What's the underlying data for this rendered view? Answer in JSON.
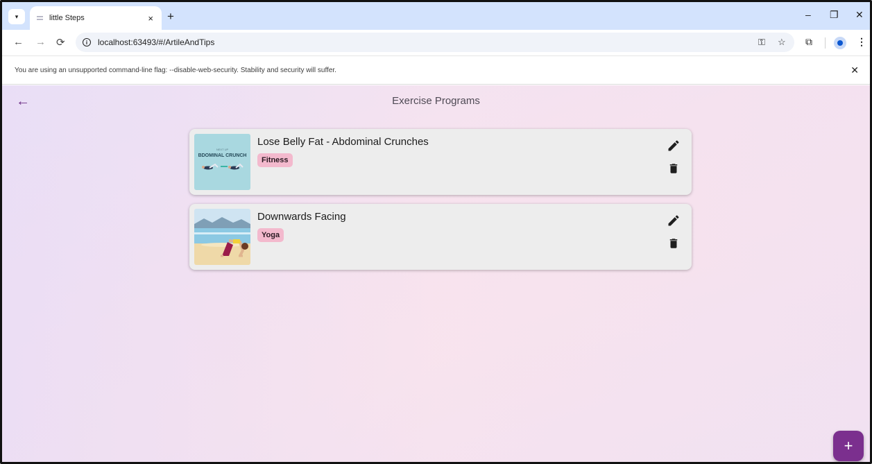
{
  "browser": {
    "tab_title": "little Steps",
    "tab_close": "×",
    "new_tab": "+",
    "url": "localhost:63493/#/ArtileAndTips",
    "window_controls": {
      "minimize": "–",
      "restore": "❐",
      "close": "✕"
    },
    "icons": [
      "tab-menu-icon",
      "back-icon",
      "forward-icon",
      "reload-icon",
      "info-icon",
      "password-key-icon",
      "bookmark-star-icon",
      "extensions-icon",
      "profile-icon",
      "more-menu-icon"
    ]
  },
  "infobar": {
    "message": "You are using an unsupported command-line flag: --disable-web-security. Stability and security will suffer.",
    "close": "✕"
  },
  "appbar": {
    "title": "Exercise Programs",
    "back_icon": "arrow-back-icon"
  },
  "programs": [
    {
      "title": "Lose Belly Fat - Abdominal Crunches",
      "category": "Fitness",
      "thumbnail_text_small": "NEXT UP",
      "thumbnail_text": "BDOMINAL CRUNCH"
    },
    {
      "title": "Downwards Facing",
      "category": "Yoga"
    }
  ],
  "fab": {
    "label": "+",
    "icon": "add-icon"
  },
  "colors": {
    "accent": "#7b2f8e",
    "chip": "#f3b9cd",
    "card": "#ededed",
    "browser_chrome": "#d3e3fd"
  }
}
